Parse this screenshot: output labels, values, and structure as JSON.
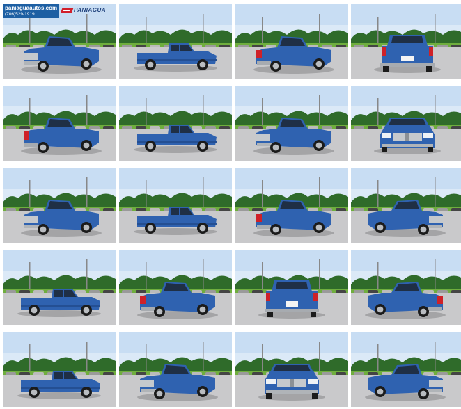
{
  "dealer": {
    "name": "paniaguaautos.com",
    "phone": "(706)529-1919",
    "logo_text": "PANIAGUA"
  },
  "colors": {
    "truck_blue": "#2f62b0",
    "sky": "#dbe9f7",
    "grass": "#6fae3e",
    "trees": "#2f6b2a",
    "pavement": "#c9c9cb"
  },
  "photos": [
    {
      "view": "front-left",
      "interactable": true
    },
    {
      "view": "side-left",
      "interactable": true
    },
    {
      "view": "rear-left",
      "interactable": true
    },
    {
      "view": "rear",
      "interactable": true
    },
    {
      "view": "rear-left",
      "interactable": true
    },
    {
      "view": "side-left",
      "interactable": true
    },
    {
      "view": "front-left",
      "interactable": true
    },
    {
      "view": "front",
      "interactable": true
    },
    {
      "view": "front-left",
      "interactable": true
    },
    {
      "view": "side-left",
      "interactable": true
    },
    {
      "view": "rear-left",
      "interactable": true
    },
    {
      "view": "front-right",
      "interactable": true
    },
    {
      "view": "side-left",
      "interactable": true
    },
    {
      "view": "rear-left",
      "interactable": true
    },
    {
      "view": "rear",
      "interactable": true
    },
    {
      "view": "rear-right",
      "interactable": true
    },
    {
      "view": "side-left",
      "interactable": true
    },
    {
      "view": "front-left",
      "interactable": true
    },
    {
      "view": "front",
      "interactable": true
    },
    {
      "view": "front-right",
      "interactable": true
    }
  ]
}
